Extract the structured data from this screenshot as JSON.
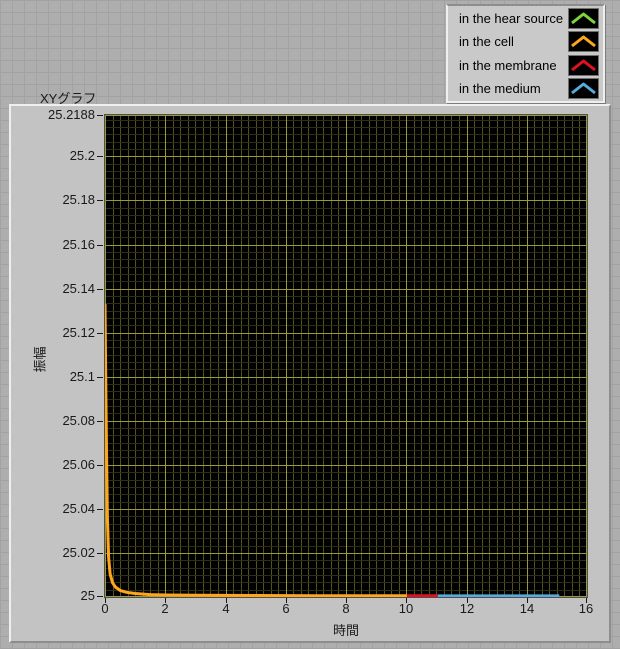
{
  "graph": {
    "title": "XYグラフ"
  },
  "legend": {
    "items": [
      {
        "label": "in the hear source",
        "color": "#7cd63e",
        "swatch_icon": "chevron-up-line"
      },
      {
        "label": "in the cell",
        "color": "#ffa71c",
        "swatch_icon": "chevron-up-line"
      },
      {
        "label": "in the membrane",
        "color": "#e01222",
        "swatch_icon": "chevron-up-line"
      },
      {
        "label": "in the medium",
        "color": "#57aade",
        "swatch_icon": "chevron-up-line"
      }
    ]
  },
  "chart_data": {
    "type": "line",
    "title": "XYグラフ",
    "xlabel": "時間",
    "ylabel": "振幅",
    "xlim": [
      0,
      16
    ],
    "ylim": [
      25,
      25.2188
    ],
    "plot_bg": "#000000",
    "grid": {
      "visible": true,
      "major_color": "#9a9a3b",
      "minor_x_color": "#52521f",
      "minor_y_color": "#2e2e14",
      "minor_x_step": 0.25,
      "minor_y_step": 0.0033333
    },
    "legend_position": "top-right",
    "x_ticks": [
      {
        "v": 0,
        "label": "0"
      },
      {
        "v": 2,
        "label": "2"
      },
      {
        "v": 4,
        "label": "4"
      },
      {
        "v": 6,
        "label": "6"
      },
      {
        "v": 8,
        "label": "8"
      },
      {
        "v": 10,
        "label": "10"
      },
      {
        "v": 12,
        "label": "12"
      },
      {
        "v": 14,
        "label": "14"
      },
      {
        "v": 16,
        "label": "16"
      }
    ],
    "y_ticks": [
      {
        "v": 25.2188,
        "label": "25.2188"
      },
      {
        "v": 25.2,
        "label": "25.2"
      },
      {
        "v": 25.18,
        "label": "25.18"
      },
      {
        "v": 25.16,
        "label": "25.16"
      },
      {
        "v": 25.14,
        "label": "25.14"
      },
      {
        "v": 25.12,
        "label": "25.12"
      },
      {
        "v": 25.1,
        "label": "25.1"
      },
      {
        "v": 25.08,
        "label": "25.08"
      },
      {
        "v": 25.06,
        "label": "25.06"
      },
      {
        "v": 25.04,
        "label": "25.04"
      },
      {
        "v": 25.02,
        "label": "25.02"
      },
      {
        "v": 25,
        "label": "25"
      }
    ],
    "series": [
      {
        "name": "in the hear source",
        "color": "#7cd63e",
        "line_width": 3,
        "points": []
      },
      {
        "name": "in the cell",
        "color": "#ffa71c",
        "line_width": 3,
        "points": [
          [
            0,
            25.133
          ],
          [
            0.02,
            25.104
          ],
          [
            0.05,
            25.066
          ],
          [
            0.08,
            25.036
          ],
          [
            0.12,
            25.018
          ],
          [
            0.17,
            25.0105
          ],
          [
            0.25,
            25.0065
          ],
          [
            0.35,
            25.0045
          ],
          [
            0.5,
            25.003
          ],
          [
            0.7,
            25.0022
          ],
          [
            1.0,
            25.0016
          ],
          [
            1.5,
            25.0011
          ],
          [
            2.0,
            25.0009
          ],
          [
            3.0,
            25.0008
          ],
          [
            5.0,
            25.0007
          ],
          [
            7.0,
            25.0006
          ],
          [
            10.02,
            25.0006
          ]
        ]
      },
      {
        "name": "in the membrane",
        "color": "#e01222",
        "line_width": 3,
        "points": [
          [
            10.02,
            25.0006
          ],
          [
            11.05,
            25.0006
          ]
        ]
      },
      {
        "name": "in the medium",
        "color": "#57aade",
        "line_width": 3,
        "points": [
          [
            11.05,
            25.0005
          ],
          [
            15.08,
            25.0005
          ]
        ]
      }
    ]
  }
}
